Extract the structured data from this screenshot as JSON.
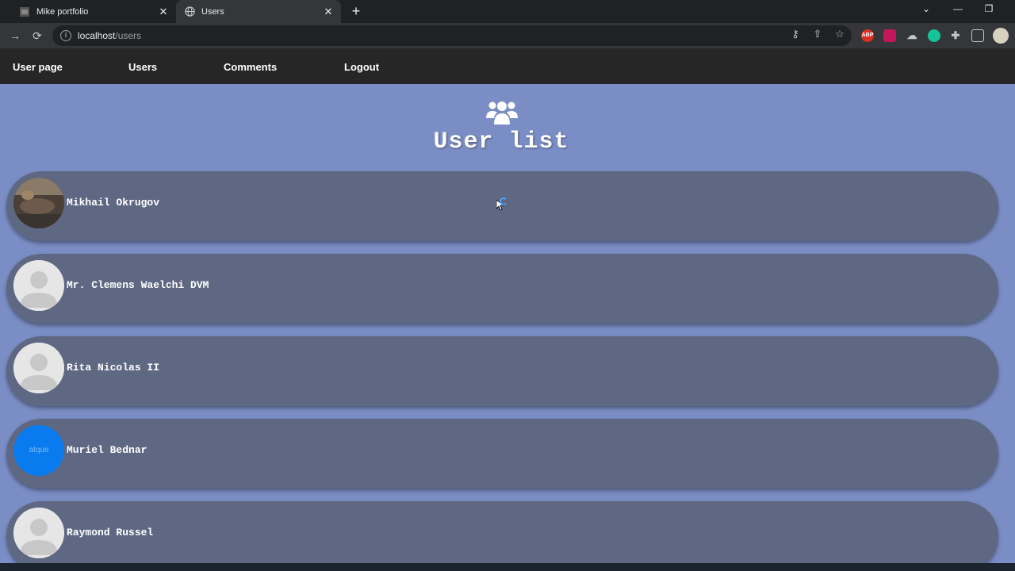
{
  "browser": {
    "tabs": [
      {
        "title": "Mike portfolio",
        "active": false
      },
      {
        "title": "Users",
        "active": true
      }
    ],
    "url_host": "localhost",
    "url_path": "/users",
    "extensions": [
      "ABP"
    ]
  },
  "nav": {
    "items": [
      "User page",
      "Users",
      "Comments",
      "Logout"
    ]
  },
  "page": {
    "title": "User list",
    "users": [
      {
        "name": "Mikhail Okrugov",
        "avatar": "photo"
      },
      {
        "name": "Mr. Clemens Waelchi DVM",
        "avatar": "default"
      },
      {
        "name": "Rita Nicolas II",
        "avatar": "default"
      },
      {
        "name": "Muriel Bednar",
        "avatar": "text",
        "avatar_text": "atque"
      },
      {
        "name": "Raymond Russel",
        "avatar": "default"
      }
    ]
  },
  "colors": {
    "content_bg": "#7a8dc4",
    "card_bg": "#5e6883",
    "nav_bg": "#262626",
    "blue_avatar": "#0a7bef"
  }
}
